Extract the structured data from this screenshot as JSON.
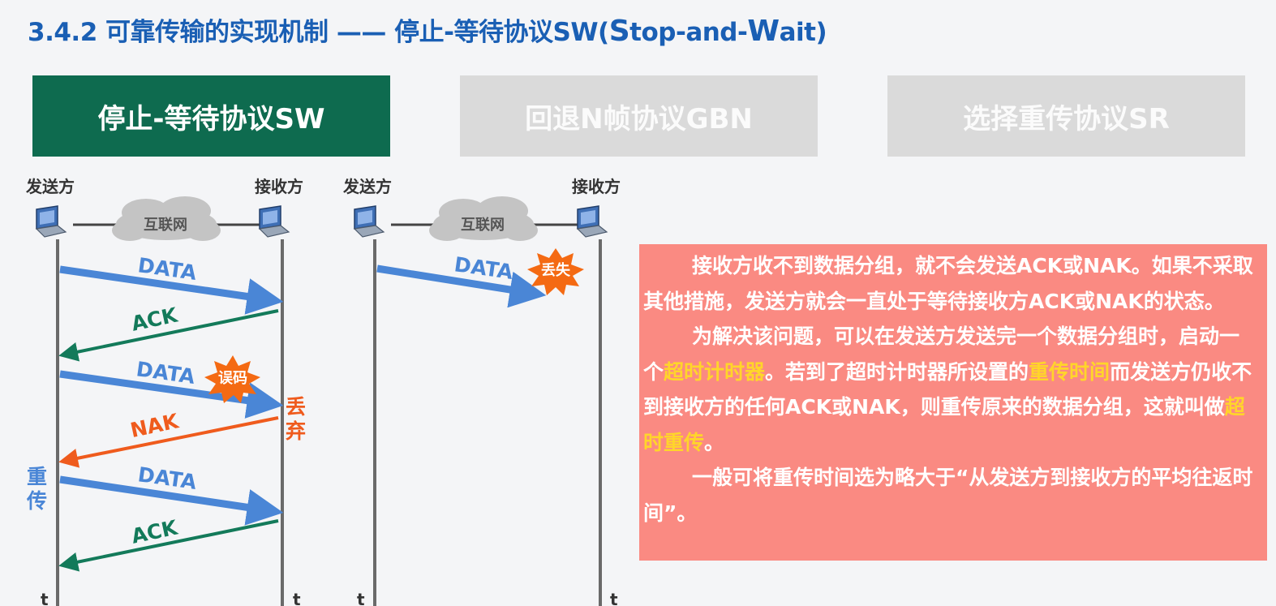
{
  "title": {
    "prefix": "3.4.2 可靠传输的实现机制 —— 停止-等待协议SW(",
    "s": "S",
    "top": "top-and-",
    "w": "W",
    "ait": "ait)"
  },
  "tabs": [
    "停止-等待协议SW",
    "回退N帧协议GBN",
    "选择重传协议SR"
  ],
  "left_diagram": {
    "sender": "发送方",
    "receiver": "接收方",
    "cloud": "互联网",
    "frames": [
      "DATA",
      "ACK",
      "DATA",
      "NAK",
      "DATA",
      "ACK"
    ],
    "error_badge": "误码",
    "discard": [
      "丢",
      "弃"
    ],
    "resend": [
      "重",
      "传"
    ],
    "time_axis": [
      "t",
      "t"
    ]
  },
  "right_diagram": {
    "sender": "发送方",
    "receiver": "接收方",
    "cloud": "互联网",
    "frame": "DATA",
    "lost_badge": "丢失",
    "time_axis": [
      "t",
      "t"
    ]
  },
  "colors": {
    "data": "#4a86d6",
    "ack": "#137a5a",
    "nak": "#ef5b1d",
    "badge": "#f46a13",
    "title": "#1a5fb4",
    "active_tab": "#0e6b4f",
    "highlight": "#ffd52a",
    "panel": "#fa8a82"
  },
  "info": {
    "p1": "接收方收不到数据分组，就不会发送ACK或NAK。如果不采取其他措施，发送方就会一直处于等待接收方ACK或NAK的状态。",
    "p2a": "为解决该问题，可以在发送方发送完一个数据分组时，启动一个",
    "p2b": "超时计时器",
    "p2c": "。若到了超时计时器所设置的",
    "p2d": "重传时间",
    "p2e": "而发送方仍收不到接收方的任何ACK或NAK，则重传原来的数据分组，这就叫做",
    "p2f": "超时重传",
    "p2g": "。",
    "p3": "一般可将重传时间选为略大于“从发送方到接收方的平均往返时间”。"
  }
}
